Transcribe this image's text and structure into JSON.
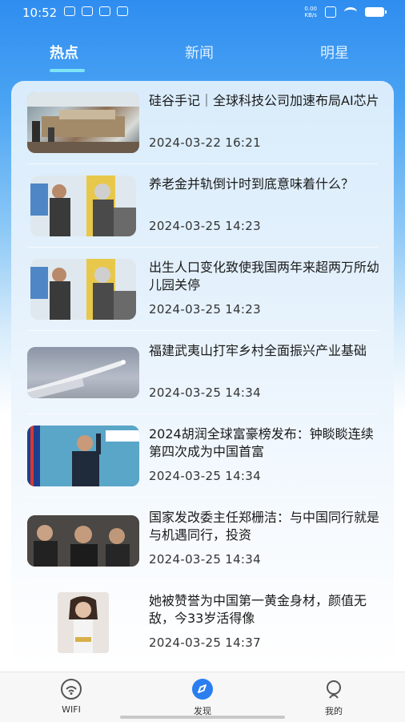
{
  "status_bar": {
    "time": "10:52",
    "net_speed_value": "0.00",
    "net_speed_unit": "KB/s"
  },
  "tabs": [
    {
      "label": "热点",
      "active": true
    },
    {
      "label": "新闻",
      "active": false
    },
    {
      "label": "明星",
      "active": false
    }
  ],
  "news": [
    {
      "title": "硅谷手记｜全球科技公司加速布局AI芯片",
      "date": "2024-03-22 16:21",
      "image": "exhibition-hall-photo"
    },
    {
      "title": "养老金并轨倒计时到底意味着什么？",
      "date": "2024-03-25 14:23",
      "image": "robot-and-woman-photo"
    },
    {
      "title": "出生人口变化致使我国两年来超两万所幼儿园关停",
      "date": "2024-03-25 14:23",
      "image": "robot-and-woman-photo"
    },
    {
      "title": "福建武夷山打牢乡村全面振兴产业基础",
      "date": "2024-03-25 14:34",
      "image": "missile-launch-photo"
    },
    {
      "title": "2024胡润全球富豪榜发布：钟睒睒连续第四次成为中国首富",
      "date": "2024-03-25 14:34",
      "image": "speaker-podium-photo"
    },
    {
      "title": "国家发改委主任郑栅洁：与中国同行就是与机遇同行，投资",
      "date": "2024-03-25 14:34",
      "image": "meeting-photo"
    },
    {
      "title": " 她被赞誉为中国第一黄金身材，颜值无敌，今33岁活得像",
      "date": "2024-03-25 14:37",
      "image": "woman-portrait-photo"
    }
  ],
  "bottom_nav": [
    {
      "label": "WIFI",
      "icon": "wifi-icon",
      "active": false
    },
    {
      "label": "发现",
      "icon": "compass-icon",
      "active": true
    },
    {
      "label": "我的",
      "icon": "user-icon",
      "active": false
    }
  ],
  "colors": {
    "header_blue": "#2f8df0",
    "tab_indicator": "#7de6f6",
    "nav_active": "#2a7ef0"
  }
}
